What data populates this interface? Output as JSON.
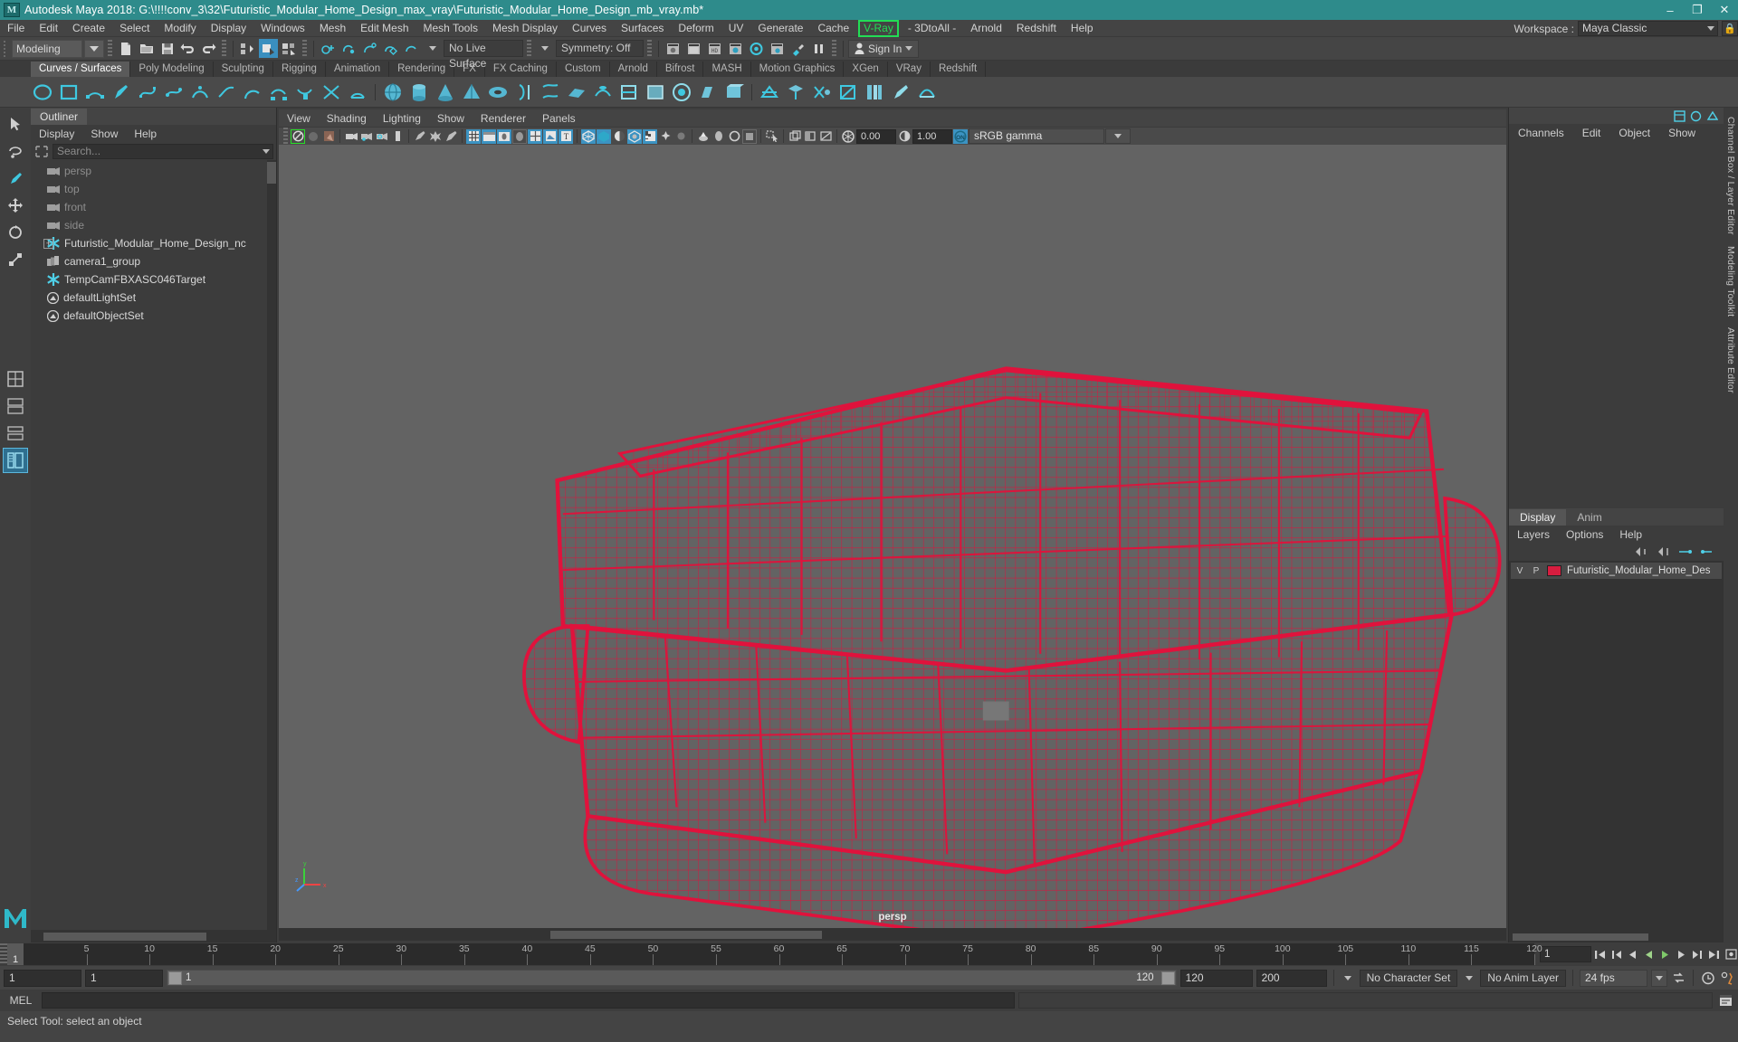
{
  "titlebar": {
    "logo": "M",
    "title": "Autodesk Maya 2018: G:\\!!!!conv_3\\32\\Futuristic_Modular_Home_Design_max_vray\\Futuristic_Modular_Home_Design_mb_vray.mb*",
    "minimize": "–",
    "maximize": "❐",
    "close": "✕",
    "bg": "#2e8b8b"
  },
  "menubar": {
    "items": [
      "File",
      "Edit",
      "Create",
      "Select",
      "Modify",
      "Display",
      "Windows",
      "Mesh",
      "Edit Mesh",
      "Mesh Tools",
      "Mesh Display",
      "Curves",
      "Surfaces",
      "Deform",
      "UV",
      "Generate",
      "Cache"
    ],
    "highlight": {
      "label": "V-Ray",
      "color": "#22dd55"
    },
    "after_highlight": [
      "- 3DtoAll -",
      "Arnold",
      "Redshift",
      "Help"
    ],
    "workspace_label": "Workspace :",
    "workspace_value": "Maya Classic",
    "lock_icon": "lock-icon"
  },
  "statusbar": {
    "mode": "Modeling",
    "live_surface": "No Live Surface",
    "symmetry": "Symmetry: Off",
    "signin": "Sign In"
  },
  "shelf": {
    "tabs": [
      "Curves / Surfaces",
      "Poly Modeling",
      "Sculpting",
      "Rigging",
      "Animation",
      "Rendering",
      "FX",
      "FX Caching",
      "Custom",
      "Arnold",
      "Bifrost",
      "MASH",
      "Motion Graphics",
      "XGen",
      "VRay",
      "Redshift"
    ],
    "active_tab": "Curves / Surfaces"
  },
  "outliner": {
    "tab": "Outliner",
    "menus": [
      "Display",
      "Show",
      "Help"
    ],
    "search_placeholder": "Search...",
    "items": [
      {
        "label": "persp",
        "icon": "camera-icon",
        "dim": true,
        "expand": false
      },
      {
        "label": "top",
        "icon": "camera-icon",
        "dim": true,
        "expand": false
      },
      {
        "label": "front",
        "icon": "camera-icon",
        "dim": true,
        "expand": false
      },
      {
        "label": "side",
        "icon": "camera-icon",
        "dim": true,
        "expand": false
      },
      {
        "label": "Futuristic_Modular_Home_Design_nc",
        "icon": "transform-icon",
        "dim": false,
        "expand": true
      },
      {
        "label": "camera1_group",
        "icon": "group-icon",
        "dim": false,
        "expand": false
      },
      {
        "label": "TempCamFBXASC046Target",
        "icon": "transform-icon",
        "dim": false,
        "expand": false
      },
      {
        "label": "defaultLightSet",
        "icon": "set-icon",
        "dim": false,
        "expand": false
      },
      {
        "label": "defaultObjectSet",
        "icon": "set-icon",
        "dim": false,
        "expand": false
      }
    ]
  },
  "viewport": {
    "menus": [
      "View",
      "Shading",
      "Lighting",
      "Show",
      "Renderer",
      "Panels"
    ],
    "exposure": "0.00",
    "gamma_value": "1.00",
    "color_profile": "sRGB gamma",
    "camera_label": "persp",
    "axis": {
      "x": "x",
      "y": "y",
      "z": "z"
    },
    "model_color": "#e0123c",
    "bg_color": "#636363"
  },
  "rightpanel": {
    "tabs": [
      "Channels",
      "Edit",
      "Object",
      "Show"
    ],
    "layer_tabs": [
      "Display",
      "Anim"
    ],
    "layer_tabs_active": "Display",
    "layer_menus": [
      "Layers",
      "Options",
      "Help"
    ],
    "layer_rows": [
      {
        "v": "V",
        "p": "P",
        "name": "Futuristic_Modular_Home_Des",
        "color": "#d81d3f"
      }
    ],
    "vertical_tabs": [
      "Channel Box / Layer Editor",
      "Modeling Toolkit",
      "Attribute Editor"
    ]
  },
  "timeline": {
    "current_frame": "1",
    "ticks": [
      5,
      10,
      15,
      20,
      25,
      30,
      35,
      40,
      45,
      50,
      55,
      60,
      65,
      70,
      75,
      80,
      85,
      90,
      95,
      100,
      105,
      110,
      115,
      120
    ],
    "range_start": "1",
    "playback_start": "1",
    "slider_left_value": "1",
    "slider_right_value": "120",
    "playback_end": "120",
    "range_end": "200",
    "character_set": "No Character Set",
    "anim_layer": "No Anim Layer",
    "fps": "24 fps",
    "frame_field": "1"
  },
  "mel": {
    "label": "MEL",
    "command_value": "",
    "output_value": ""
  },
  "helpline": {
    "text": "Select Tool: select an object"
  }
}
